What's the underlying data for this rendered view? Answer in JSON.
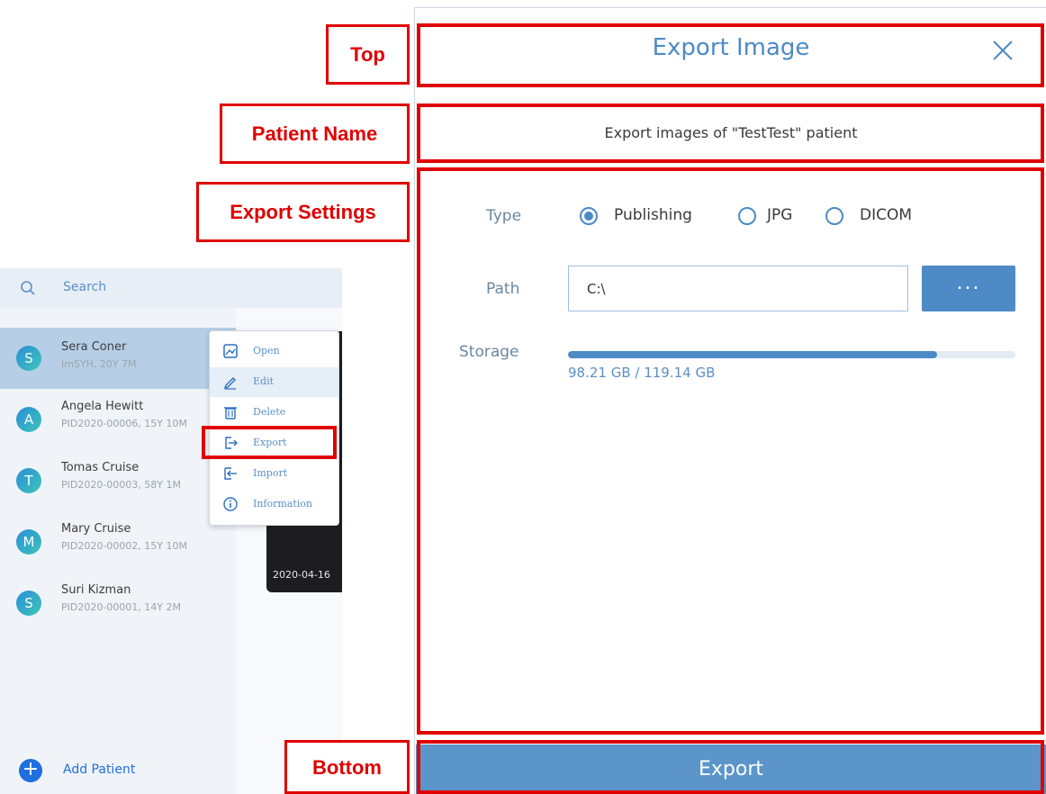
{
  "search": {
    "placeholder": "Search"
  },
  "patients": [
    {
      "initial": "S",
      "name": "Sera Coner",
      "sub": "ImSYH, 20Y 7M"
    },
    {
      "initial": "A",
      "name": "Angela Hewitt",
      "sub": "PID2020-00006, 15Y 10M"
    },
    {
      "initial": "T",
      "name": "Tomas Cruise",
      "sub": "PID2020-00003, 58Y 1M"
    },
    {
      "initial": "M",
      "name": "Mary Cruise",
      "sub": "PID2020-00002, 15Y 10M"
    },
    {
      "initial": "S",
      "name": "Suri Kizman",
      "sub": "PID2020-00001, 14Y 2M"
    }
  ],
  "thumbnail": {
    "date": "2020-04-16"
  },
  "context_menu": [
    {
      "label": "Open",
      "icon": "image-icon"
    },
    {
      "label": "Edit",
      "icon": "pencil-icon"
    },
    {
      "label": "Delete",
      "icon": "trash-icon"
    },
    {
      "label": "Export",
      "icon": "export-icon"
    },
    {
      "label": "Import",
      "icon": "import-icon"
    },
    {
      "label": "Information",
      "icon": "info-icon"
    }
  ],
  "add_patient": {
    "label": "Add Patient"
  },
  "annotations": {
    "top": "Top",
    "patient_name": "Patient Name",
    "export_settings": "Export Settings",
    "bottom": "Bottom"
  },
  "dialog": {
    "title": "Export Image",
    "patient_line": "Export images of \"TestTest\" patient",
    "type_label": "Type",
    "type_options": [
      "Publishing",
      "JPG",
      "DICOM"
    ],
    "type_selected": "Publishing",
    "path_label": "Path",
    "path_value": "C:\\",
    "browse_label": "...",
    "storage_label": "Storage",
    "storage_used_gb": 98.21,
    "storage_total_gb": 119.14,
    "storage_text": "98.21 GB / 119.14 GB",
    "export_button": "Export"
  },
  "colors": {
    "accent": "#4d8ac6",
    "annotation": "#e00000",
    "selected_row": "#b7cfe6"
  }
}
